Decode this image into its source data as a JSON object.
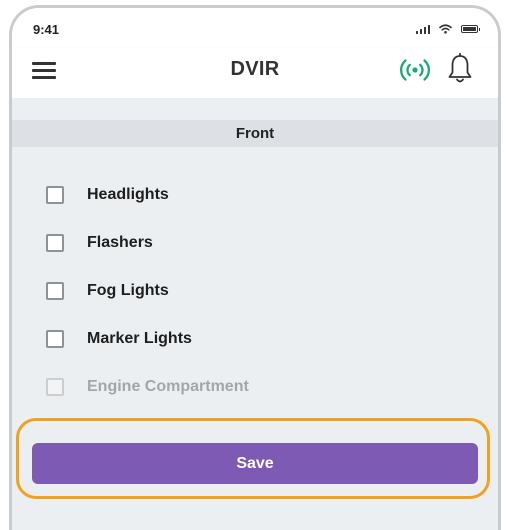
{
  "status_bar": {
    "time": "9:41",
    "icons": [
      "signal-icon",
      "wifi-icon",
      "battery-icon"
    ]
  },
  "app_bar": {
    "title": "DVIR",
    "menu_icon": "hamburger-menu-icon",
    "connection_icon": "broadcast-icon",
    "notification_icon": "bell-icon",
    "connection_color": "#1aa874"
  },
  "section": {
    "title": "Front"
  },
  "items": [
    {
      "label": "Headlights",
      "checked": false
    },
    {
      "label": "Flashers",
      "checked": false
    },
    {
      "label": "Fog Lights",
      "checked": false
    },
    {
      "label": "Marker Lights",
      "checked": false
    },
    {
      "label": "Engine Compartment",
      "checked": false
    }
  ],
  "save": {
    "label": "Save",
    "color": "#7d5bb5",
    "highlight_color": "#f2a11e"
  }
}
